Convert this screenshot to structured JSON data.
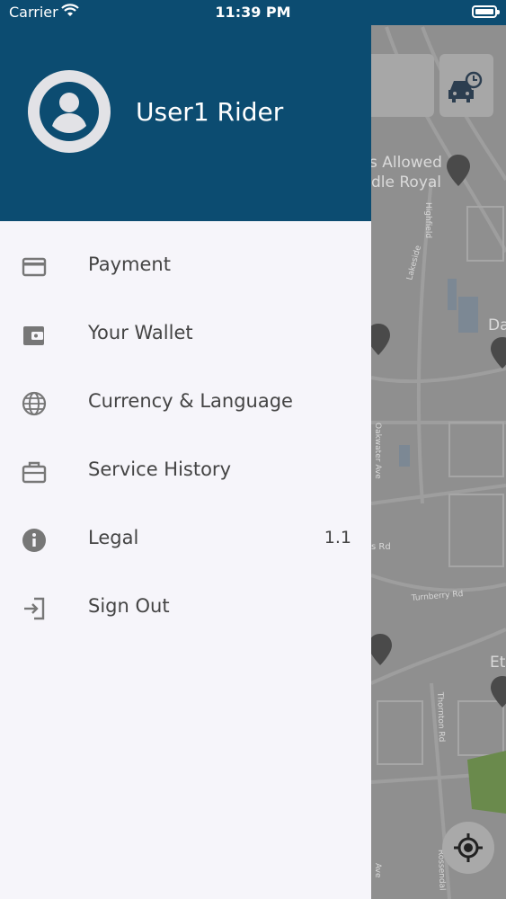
{
  "status_bar": {
    "carrier": "Carrier",
    "time": "11:39 PM",
    "battery_level": 1.0
  },
  "map": {
    "labels": {
      "allowed": "s Allowed",
      "royal": "dle Royal",
      "highfield": "Highfield",
      "lakeside": "Lakeside",
      "da": "Da",
      "oakwater": "Oakwater Ave",
      "rd": "s Rd",
      "turnberry": "Turnberry Rd",
      "et": "Et",
      "thornton": "Thornton Rd",
      "rossendal": "Rossendal",
      "ave": "Ave"
    }
  },
  "drawer": {
    "user_name": "User1 Rider",
    "menu": [
      {
        "label": "Payment",
        "icon": "credit-card-icon"
      },
      {
        "label": "Your Wallet",
        "icon": "wallet-icon"
      },
      {
        "label": "Currency & Language",
        "icon": "globe-icon"
      },
      {
        "label": "Service History",
        "icon": "briefcase-icon"
      },
      {
        "label": "Legal",
        "icon": "info-icon",
        "value": "1.1"
      },
      {
        "label": "Sign Out",
        "icon": "sign-out-icon"
      }
    ]
  },
  "colors": {
    "header": "#0c4c71",
    "drawer_bg": "#f6f5fa",
    "icon": "#777777",
    "text": "#444444",
    "map_bg": "#8f8f8f"
  }
}
